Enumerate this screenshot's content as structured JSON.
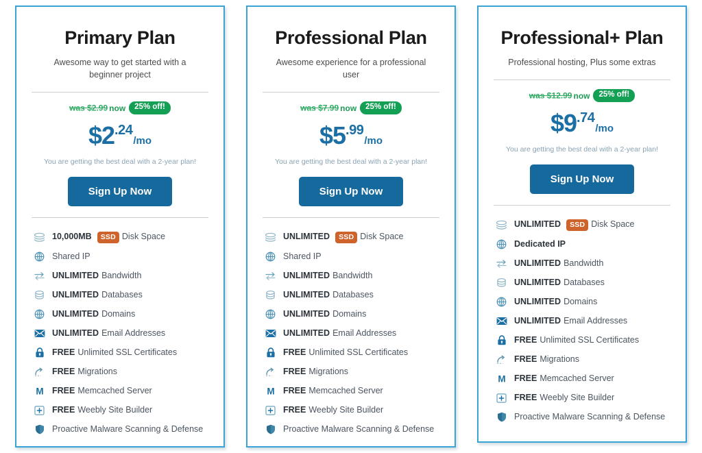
{
  "plans": [
    {
      "title": "Primary Plan",
      "subtitle": "Awesome way to get started with a beginner project",
      "was_label": "was $2.99",
      "now_label": "now",
      "discount_badge": "25% off!",
      "price_main": "$2",
      "price_cents": ".24",
      "price_per": "/mo",
      "deal_note": "You are getting the best deal with a 2-year plan!",
      "cta_label": "Sign Up Now",
      "features": [
        {
          "icon": "disk-stack-icon",
          "strong": "10,000MB",
          "badge": "SSD",
          "rest": "Disk Space"
        },
        {
          "icon": "globe-icon",
          "strong": "",
          "badge": "",
          "rest": "Shared IP"
        },
        {
          "icon": "bandwidth-arrows-icon",
          "strong": "UNLIMITED",
          "badge": "",
          "rest": "Bandwidth"
        },
        {
          "icon": "database-icon",
          "strong": "UNLIMITED",
          "badge": "",
          "rest": "Databases"
        },
        {
          "icon": "globe-icon",
          "strong": "UNLIMITED",
          "badge": "",
          "rest": "Domains"
        },
        {
          "icon": "envelope-icon",
          "strong": "UNLIMITED",
          "badge": "",
          "rest": "Email Addresses"
        },
        {
          "icon": "padlock-icon",
          "strong": "FREE",
          "badge": "",
          "rest": "Unlimited SSL Certificates"
        },
        {
          "icon": "migration-arc-icon",
          "strong": "FREE",
          "badge": "",
          "rest": "Migrations"
        },
        {
          "icon": "memcached-m-icon",
          "strong": "FREE",
          "badge": "",
          "rest": "Memcached Server"
        },
        {
          "icon": "weebly-plus-box-icon",
          "strong": "FREE",
          "badge": "",
          "rest": "Weebly Site Builder"
        },
        {
          "icon": "shield-icon",
          "strong": "",
          "badge": "",
          "rest": "Proactive Malware Scanning & Defense"
        }
      ]
    },
    {
      "title": "Professional Plan",
      "subtitle": "Awesome experience for a professional user",
      "was_label": "was $7.99",
      "now_label": "now",
      "discount_badge": "25% off!",
      "price_main": "$5",
      "price_cents": ".99",
      "price_per": "/mo",
      "deal_note": "You are getting the best deal with a 2-year plan!",
      "cta_label": "Sign Up Now",
      "features": [
        {
          "icon": "disk-stack-icon",
          "strong": "UNLIMITED",
          "badge": "SSD",
          "rest": "Disk Space"
        },
        {
          "icon": "globe-icon",
          "strong": "",
          "badge": "",
          "rest": "Shared IP"
        },
        {
          "icon": "bandwidth-arrows-icon",
          "strong": "UNLIMITED",
          "badge": "",
          "rest": "Bandwidth"
        },
        {
          "icon": "database-icon",
          "strong": "UNLIMITED",
          "badge": "",
          "rest": "Databases"
        },
        {
          "icon": "globe-icon",
          "strong": "UNLIMITED",
          "badge": "",
          "rest": "Domains"
        },
        {
          "icon": "envelope-icon",
          "strong": "UNLIMITED",
          "badge": "",
          "rest": "Email Addresses"
        },
        {
          "icon": "padlock-icon",
          "strong": "FREE",
          "badge": "",
          "rest": "Unlimited SSL Certificates"
        },
        {
          "icon": "migration-arc-icon",
          "strong": "FREE",
          "badge": "",
          "rest": "Migrations"
        },
        {
          "icon": "memcached-m-icon",
          "strong": "FREE",
          "badge": "",
          "rest": "Memcached Server"
        },
        {
          "icon": "weebly-plus-box-icon",
          "strong": "FREE",
          "badge": "",
          "rest": "Weebly Site Builder"
        },
        {
          "icon": "shield-icon",
          "strong": "",
          "badge": "",
          "rest": "Proactive Malware Scanning & Defense"
        }
      ]
    },
    {
      "title": "Professional+ Plan",
      "subtitle": "Professional hosting, Plus some extras",
      "was_label": "was $12.99",
      "now_label": "now",
      "discount_badge": "25% off!",
      "price_main": "$9",
      "price_cents": ".74",
      "price_per": "/mo",
      "deal_note": "You are getting the best deal with a 2-year plan!",
      "cta_label": "Sign Up Now",
      "features": [
        {
          "icon": "disk-stack-icon",
          "strong": "UNLIMITED",
          "badge": "SSD",
          "rest": "Disk Space"
        },
        {
          "icon": "globe-icon",
          "strong": "Dedicated IP",
          "badge": "",
          "rest": ""
        },
        {
          "icon": "bandwidth-arrows-icon",
          "strong": "UNLIMITED",
          "badge": "",
          "rest": "Bandwidth"
        },
        {
          "icon": "database-icon",
          "strong": "UNLIMITED",
          "badge": "",
          "rest": "Databases"
        },
        {
          "icon": "globe-icon",
          "strong": "UNLIMITED",
          "badge": "",
          "rest": "Domains"
        },
        {
          "icon": "envelope-icon",
          "strong": "UNLIMITED",
          "badge": "",
          "rest": "Email Addresses"
        },
        {
          "icon": "padlock-icon",
          "strong": "FREE",
          "badge": "",
          "rest": "Unlimited SSL Certificates"
        },
        {
          "icon": "migration-arc-icon",
          "strong": "FREE",
          "badge": "",
          "rest": "Migrations"
        },
        {
          "icon": "memcached-m-icon",
          "strong": "FREE",
          "badge": "",
          "rest": "Memcached Server"
        },
        {
          "icon": "weebly-plus-box-icon",
          "strong": "FREE",
          "badge": "",
          "rest": "Weebly Site Builder"
        },
        {
          "icon": "shield-icon",
          "strong": "",
          "badge": "",
          "rest": "Proactive Malware Scanning & Defense"
        }
      ]
    }
  ],
  "colors": {
    "card_border": "#3aa3d4",
    "title_text": "#1b1b1b",
    "price_blue": "#1c6fa4",
    "cta_blue": "#16699c",
    "discount_green": "#13a055",
    "was_green": "#2fab63",
    "ssd_orange": "#cf632c",
    "note_gray": "#89a3b3"
  }
}
